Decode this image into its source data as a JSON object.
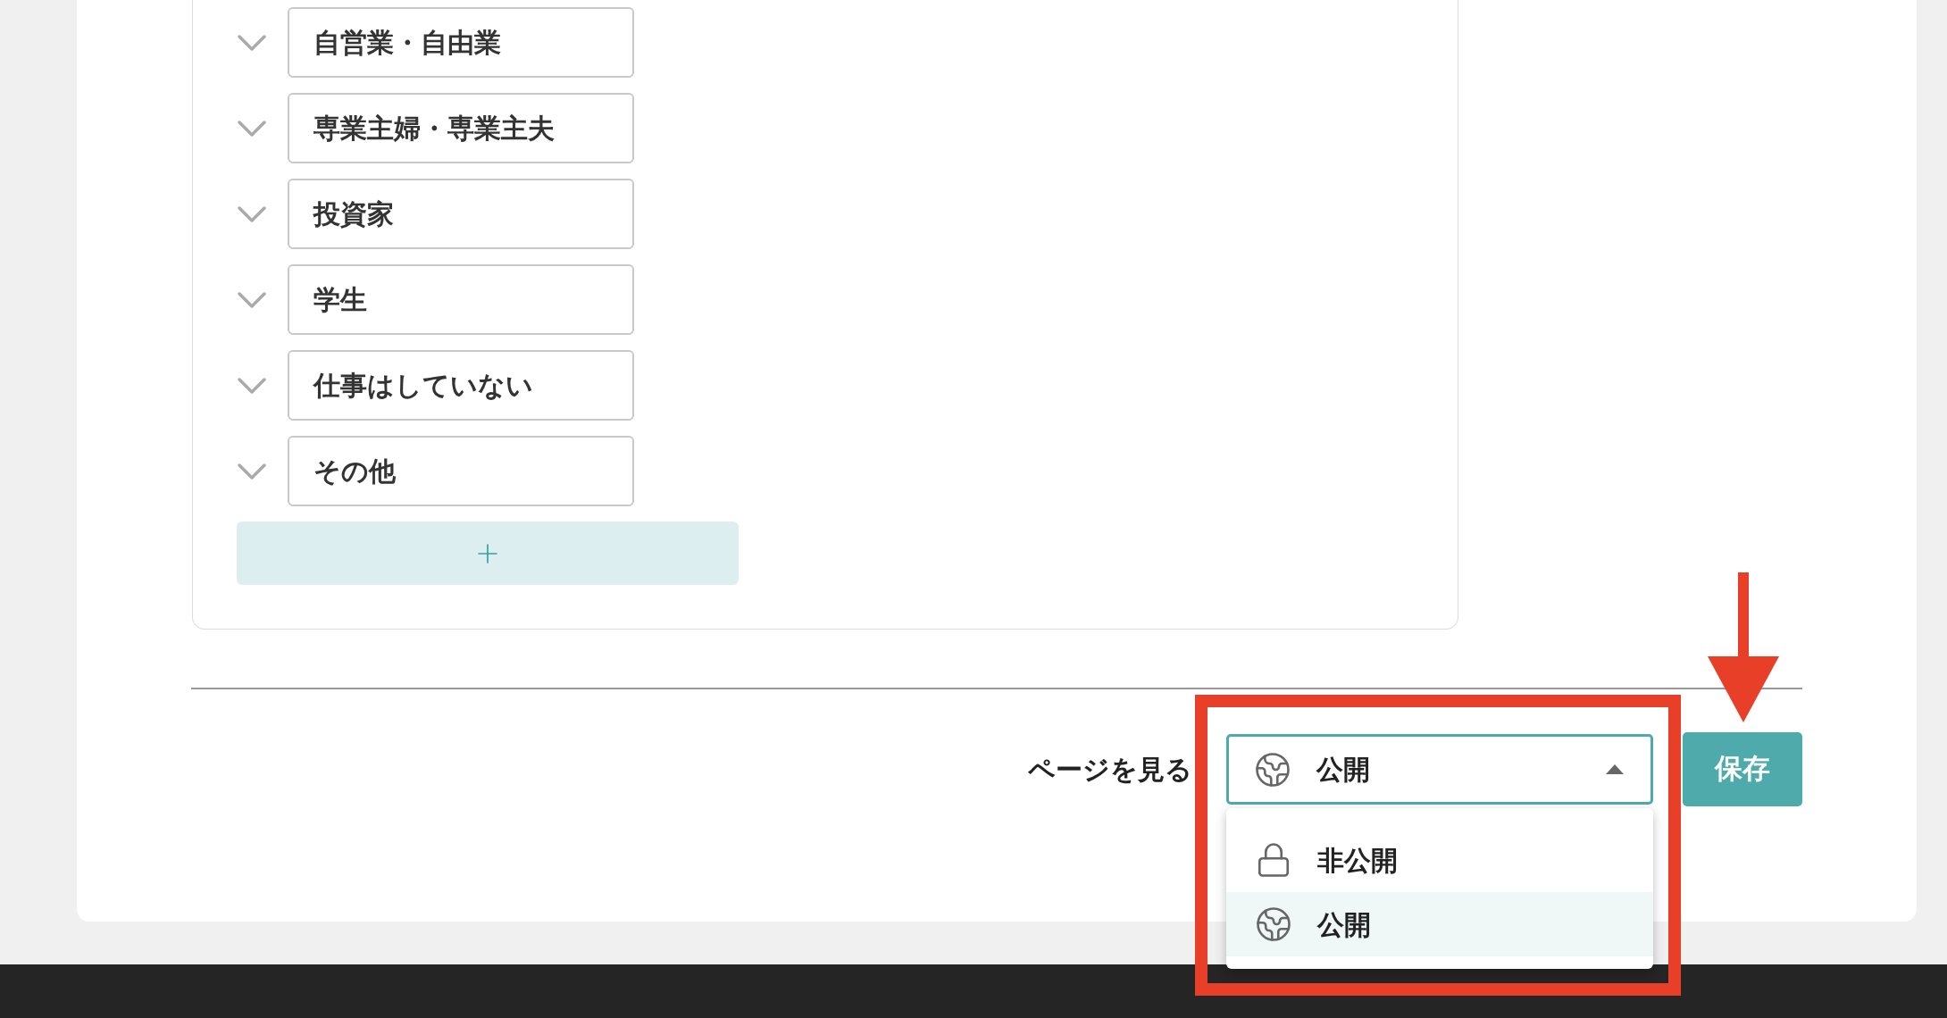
{
  "occupations": [
    {
      "label": "自営業・自由業"
    },
    {
      "label": "専業主婦・専業主夫"
    },
    {
      "label": "投資家"
    },
    {
      "label": "学生"
    },
    {
      "label": "仕事はしていない"
    },
    {
      "label": "その他"
    }
  ],
  "footer": {
    "view_page_link": "ページを見る",
    "visibility_select": {
      "value": "公開",
      "kind": "globe",
      "expanded": true,
      "options": [
        {
          "label": "非公開",
          "kind": "lock",
          "selected": false
        },
        {
          "label": "公開",
          "kind": "globe",
          "selected": true
        }
      ]
    },
    "save_button": "保存"
  }
}
